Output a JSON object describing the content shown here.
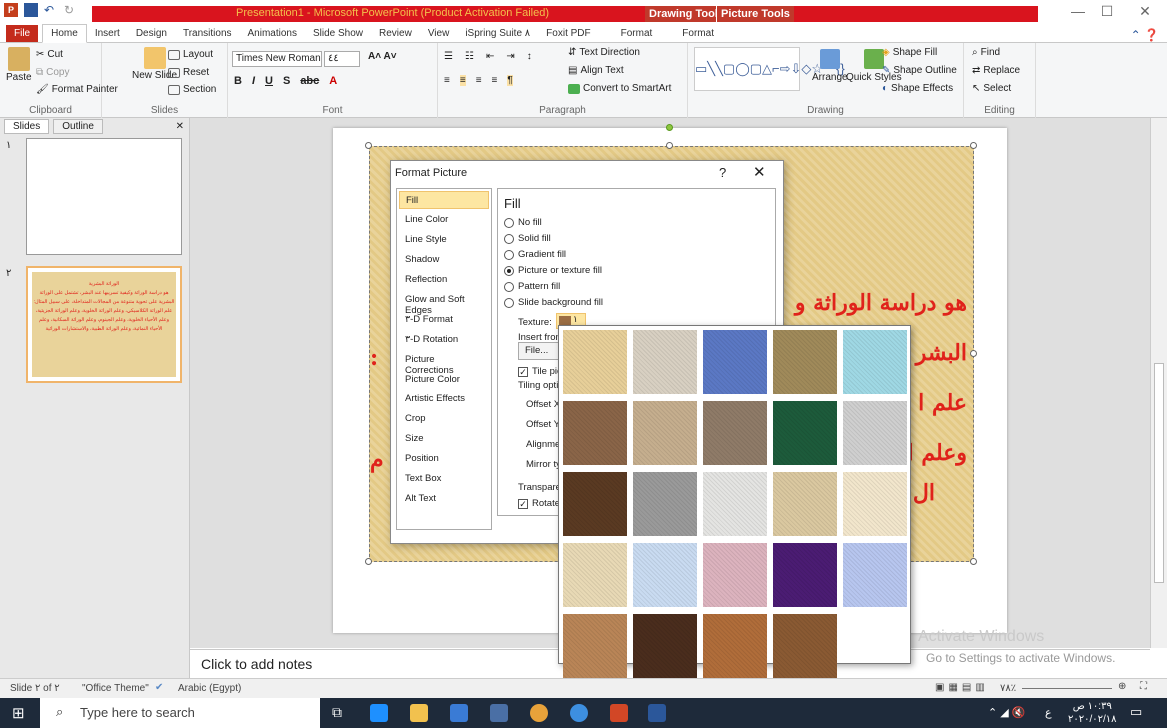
{
  "window": {
    "title": "Presentation1 - Microsoft PowerPoint (Product Activation Failed)",
    "context_drawing": "Drawing Tools",
    "context_picture": "Picture Tools",
    "min": "—",
    "max": "☐",
    "close": "✕"
  },
  "tabs": [
    "File",
    "Home",
    "Insert",
    "Design",
    "Transitions",
    "Animations",
    "Slide Show",
    "Review",
    "View",
    "iSpring Suite ٨",
    "Foxit PDF",
    "Format",
    "Format"
  ],
  "ribbon": {
    "clipboard": {
      "paste": "Paste",
      "cut": "Cut",
      "copy": "Copy",
      "format_painter": "Format Painter",
      "label": "Clipboard"
    },
    "slides": {
      "new_slide": "New Slide",
      "layout": "Layout",
      "reset": "Reset",
      "section": "Section",
      "label": "Slides"
    },
    "font": {
      "name": "Times New Roman",
      "size": "٤٤",
      "label": "Font"
    },
    "paragraph": {
      "text_direction": "Text Direction",
      "align_text": "Align Text",
      "convert_smartart": "Convert to SmartArt",
      "label": "Paragraph"
    },
    "drawing": {
      "arrange": "Arrange",
      "quick_styles": "Quick Styles",
      "shape_fill": "Shape Fill",
      "shape_outline": "Shape Outline",
      "shape_effects": "Shape Effects",
      "label": "Drawing"
    },
    "editing": {
      "find": "Find",
      "replace": "Replace",
      "select": "Select",
      "label": "Editing"
    }
  },
  "pane": {
    "tab_slides": "Slides",
    "tab_outline": "Outline",
    "close": "✕",
    "slide1_num": "١",
    "slide2_num": "٢"
  },
  "thumb2": {
    "title": "الوراثة البشرية",
    "line1": "هو دراسة الوراثة وكيفية تسريبها عند البشر، تشتمل على الوراثة",
    "line2": "البشرية على تحوية متنوعة من المجالات المتداخلة، على سبيل المثال:",
    "line3": "علم الوراثة الكلاسيكي، وعلم الوراثة الخلوية، وعلم الوراثة الجزيئية،",
    "line4": "وعلم الأحياء الخلوية، وعلم الجينوم، وعلم الوراثة السكانية، وعلم",
    "line5": "الأحياء النمائية، وعلم الوراثة الطبية، والاستشارات الوراثية"
  },
  "slide_text": {
    "line1": "هو دراسة الوراثة و",
    "line2": "البشر",
    "line3": "علم ا",
    "line4": "وعلم ا",
    "line5": "ال",
    "left_dot": ":",
    "left_mark": "م"
  },
  "dialog": {
    "title": "Format Picture",
    "help": "?",
    "close": "✕",
    "categories": [
      "Fill",
      "Line Color",
      "Line Style",
      "Shadow",
      "Reflection",
      "Glow and Soft Edges",
      "٣-D Format",
      "٣-D Rotation",
      "Picture Corrections",
      "Picture Color",
      "Artistic Effects",
      "Crop",
      "Size",
      "Position",
      "Text Box",
      "Alt Text"
    ],
    "fill_title": "Fill",
    "options": [
      "No fill",
      "Solid fill",
      "Gradient fill",
      "Picture or texture fill",
      "Pattern fill",
      "Slide background fill"
    ],
    "texture_label": "Texture:",
    "texture_num": "١",
    "insert_from": "Insert from:",
    "file_btn": "File...",
    "tile": "Tile picture as texture",
    "tiling_options": "Tiling options",
    "offset_x": "Offset X:",
    "offset_y": "Offset Y:",
    "alignment": "Alignment:",
    "mirror": "Mirror type:",
    "transparency": "Transparency:",
    "rotate": "Rotate with shape"
  },
  "notes": "Click to add notes",
  "activate": "Go to Settings to activate Windows.",
  "activate_bg": "Activate Windows",
  "status": {
    "slide": "Slide ٢ of ٢",
    "theme": "\"Office Theme\"",
    "language": "Arabic (Egypt)",
    "zoom": "٧٨٪"
  },
  "taskbar": {
    "search": "Type here to search",
    "time": "١٠:٣٩ ص",
    "date": "٢٠٢٠/٠٢/١٨",
    "lang": "ع"
  },
  "colors": {
    "accent": "#c42b1c",
    "title_red": "#d9141e",
    "slide_text": "#e0221b"
  },
  "textures": [
    [
      "#e7cf99",
      "#d8d0c2",
      "#5b78c4",
      "#a08a5a",
      "#9fd8e4"
    ],
    [
      "#8a6548",
      "#c5ae8e",
      "#8f7b68",
      "#1d5b3b",
      "#cfcfcf"
    ],
    [
      "#5a3a22",
      "#9a9a9a",
      "#e4e4e2",
      "#dac8a0",
      "#f2e6cc"
    ],
    [
      "#e8d9b5",
      "#c9dbf1",
      "#dcb3be",
      "#4b1c73",
      "#b7c6ef"
    ],
    [
      "#b98557",
      "#4a2d1d",
      "#b06d3a",
      "#8a5a33",
      ""
    ]
  ]
}
